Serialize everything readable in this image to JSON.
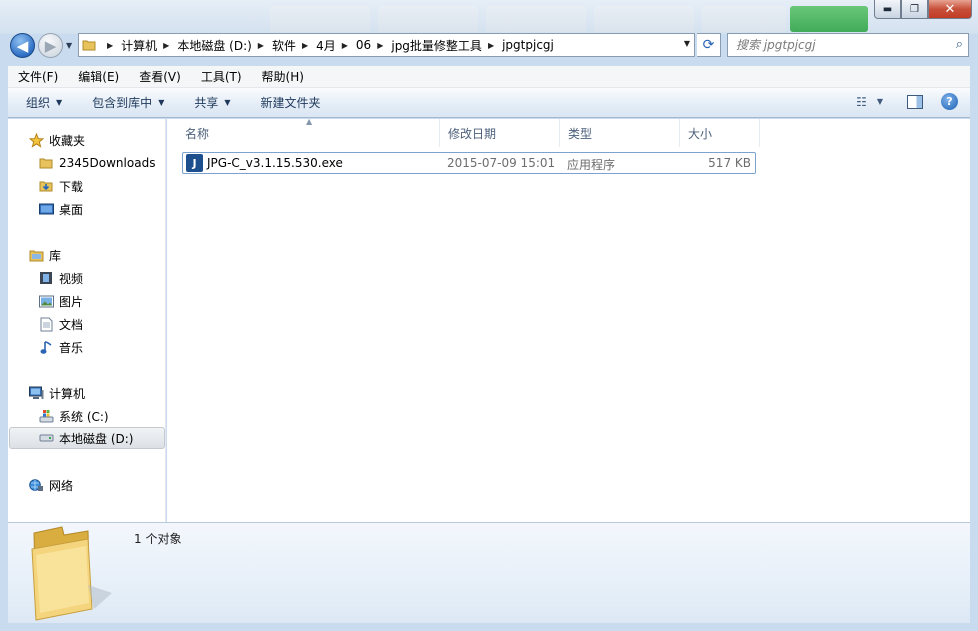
{
  "address": {
    "crumbs": [
      "计算机",
      "本地磁盘 (D:)",
      "软件",
      "4月",
      "06",
      "jpg批量修整工具",
      "jpgtpjcgj"
    ]
  },
  "search": {
    "placeholder": "搜索 jpgtpjcgj"
  },
  "menu": [
    "文件(F)",
    "编辑(E)",
    "查看(V)",
    "工具(T)",
    "帮助(H)"
  ],
  "toolbar": {
    "organize": "组织",
    "include_in_library": "包含到库中",
    "share": "共享",
    "new_folder": "新建文件夹"
  },
  "nav": {
    "favorites": "收藏夹",
    "downloads_2345": "2345Downloads",
    "downloads": "下载",
    "desktop": "桌面",
    "libraries": "库",
    "videos": "视频",
    "pictures": "图片",
    "documents": "文档",
    "music": "音乐",
    "computer": "计算机",
    "system_c": "系统 (C:)",
    "local_d": "本地磁盘 (D:)",
    "network": "网络"
  },
  "columns": {
    "name": "名称",
    "modified": "修改日期",
    "type": "类型",
    "size": "大小"
  },
  "files": [
    {
      "name": "JPG-C_v3.1.15.530.exe",
      "modified": "2015-07-09 15:01",
      "type": "应用程序",
      "size": "517 KB"
    }
  ],
  "status": {
    "count": "1 个对象"
  },
  "colors": {
    "accent": "#1d4f8f",
    "header_text": "#4c607a",
    "muted_text": "#6d6d6d"
  }
}
